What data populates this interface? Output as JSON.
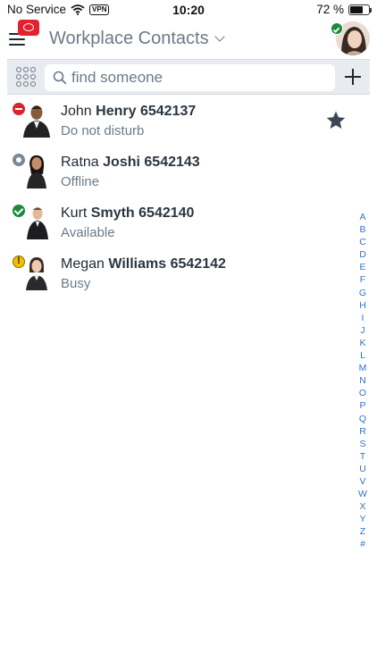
{
  "status_bar": {
    "carrier": "No Service",
    "vpn": "VPN",
    "time": "10:20",
    "battery": "72 %",
    "battery_level": 0.72
  },
  "header": {
    "title": "Workplace Contacts"
  },
  "search": {
    "placeholder": "find someone"
  },
  "contacts": [
    {
      "first_name": "John",
      "last_name": "Henry",
      "number": "6542137",
      "status": "Do not disturb",
      "presence": "dnd",
      "favorite": true
    },
    {
      "first_name": "Ratna",
      "last_name": "Joshi",
      "number": "6542143",
      "status": "Offline",
      "presence": "offline",
      "favorite": false
    },
    {
      "first_name": "Kurt",
      "last_name": "Smyth",
      "number": "6542140",
      "status": "Available",
      "presence": "available",
      "favorite": false
    },
    {
      "first_name": "Megan",
      "last_name": "Williams",
      "number": "6542142",
      "status": "Busy",
      "presence": "busy",
      "favorite": false
    }
  ],
  "alphabet_index": [
    "A",
    "B",
    "C",
    "D",
    "E",
    "F",
    "G",
    "H",
    "I",
    "J",
    "K",
    "L",
    "M",
    "N",
    "O",
    "P",
    "Q",
    "R",
    "S",
    "T",
    "U",
    "V",
    "W",
    "X",
    "Y",
    "Z",
    "#"
  ],
  "colors": {
    "dnd": "#d7262f",
    "available": "#1b8a3a",
    "busy": "#f2c000",
    "offline": "#7a8794",
    "index_link": "#2f74c9",
    "badge": "#e4222f"
  }
}
